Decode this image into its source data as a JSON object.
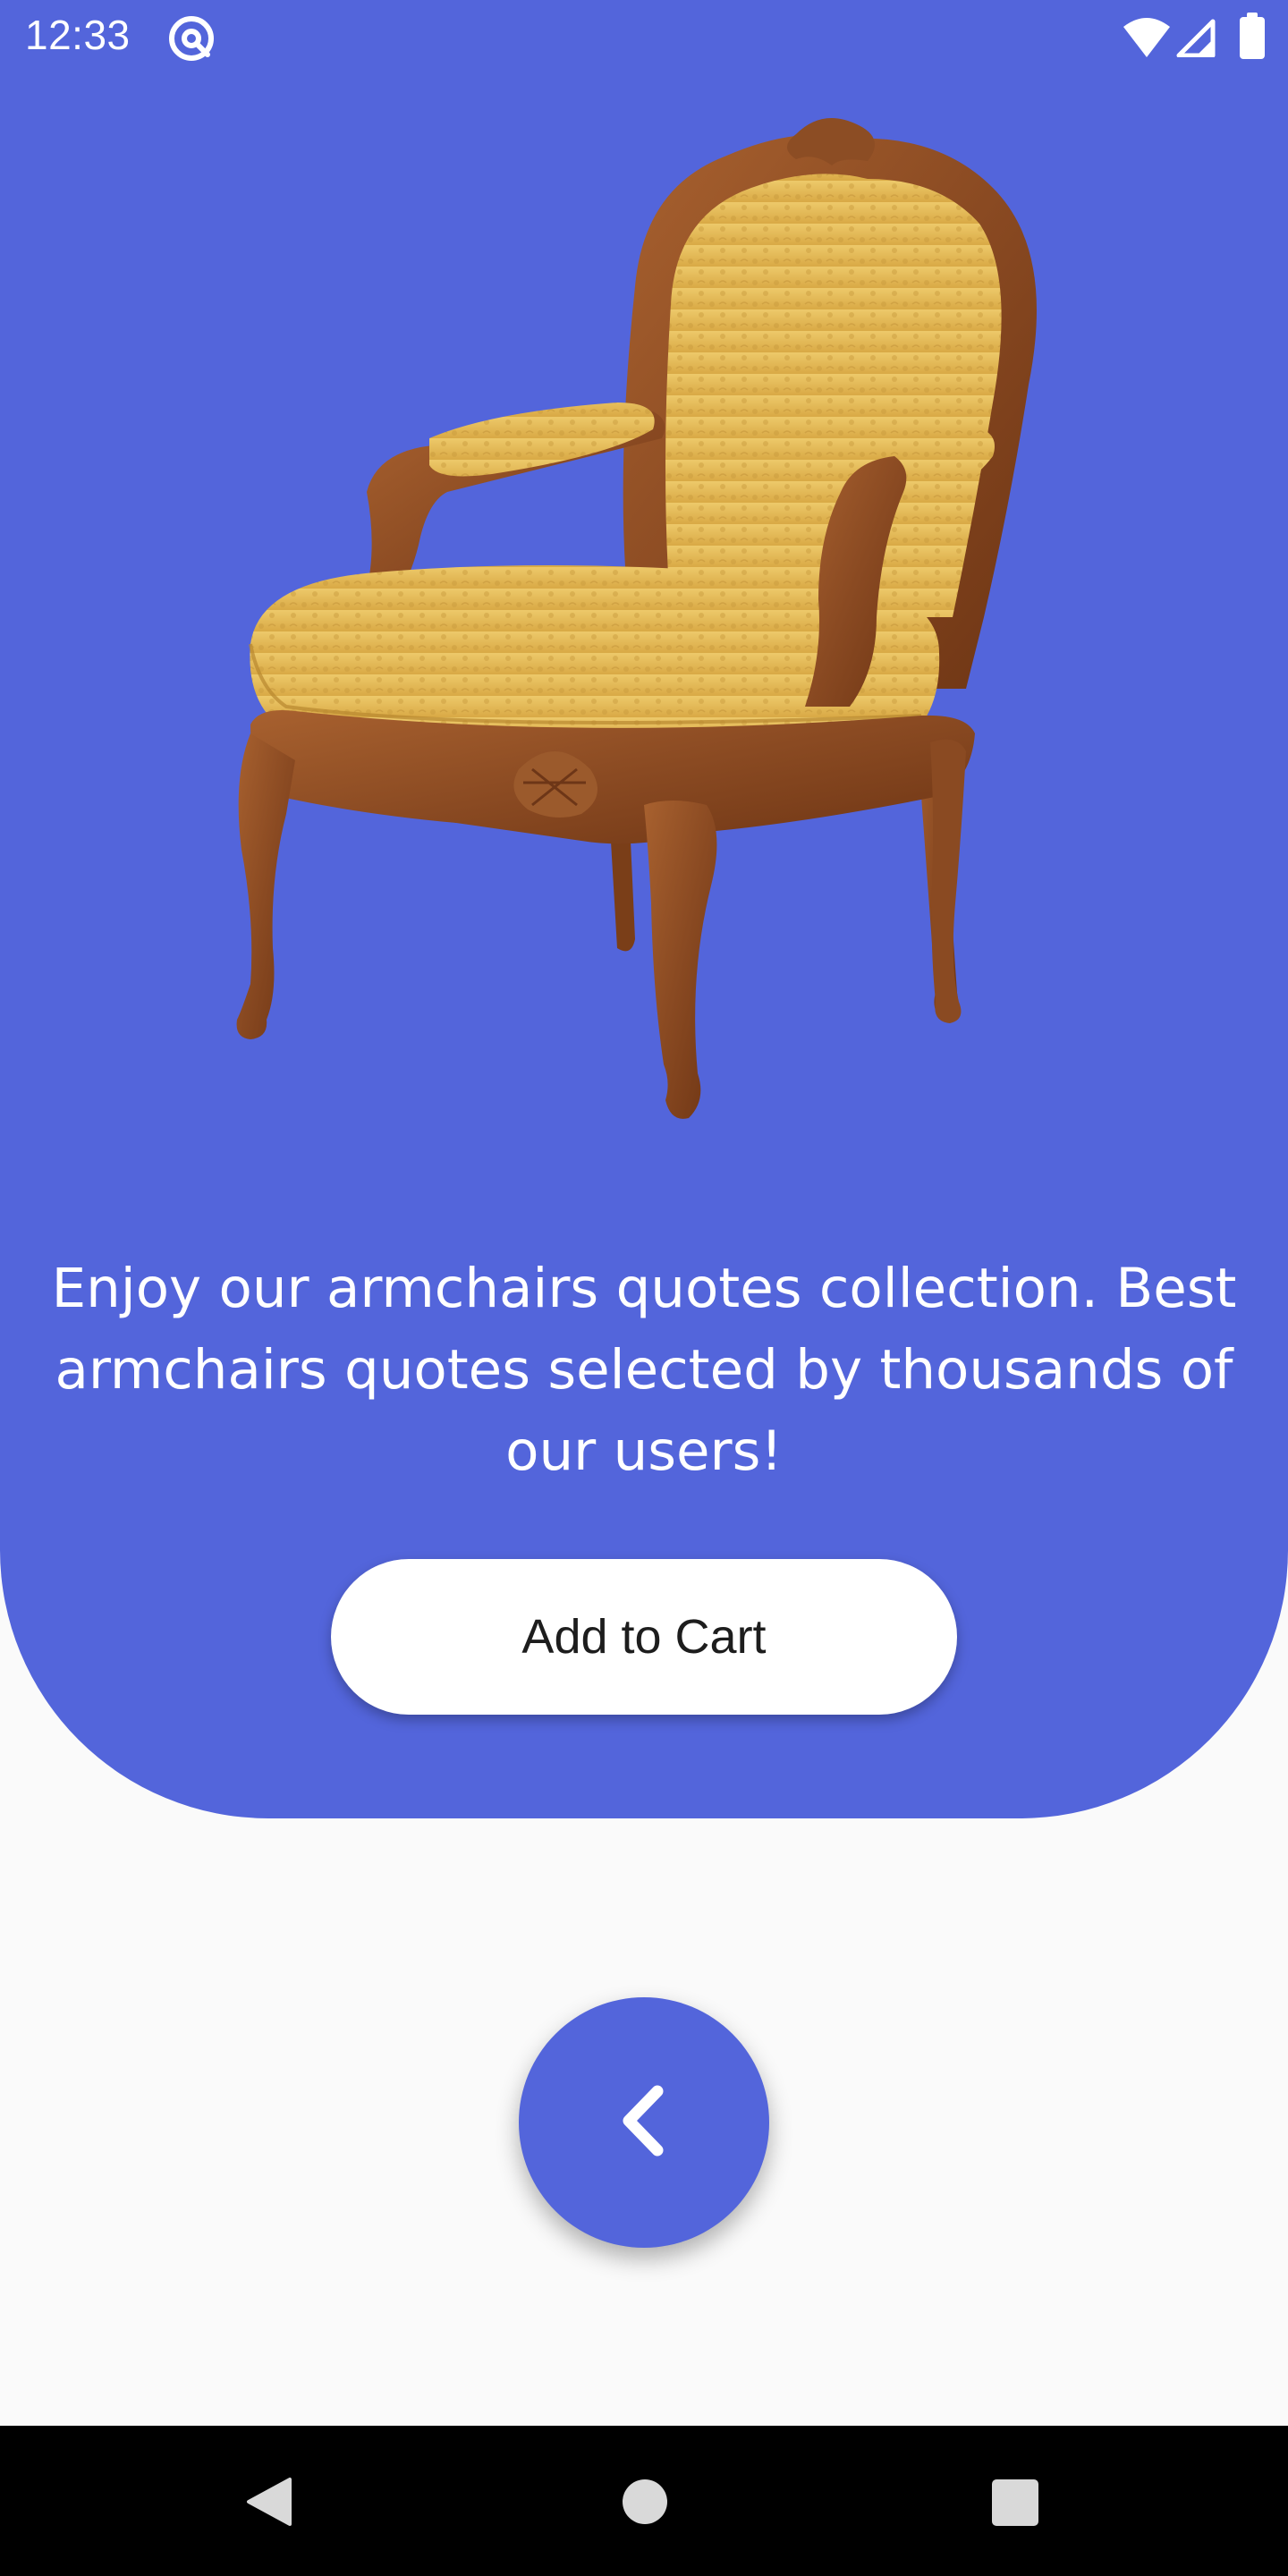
{
  "status_bar": {
    "time": "12:33",
    "icons": [
      "at-sign-icon",
      "wifi-icon",
      "cell-signal-icon",
      "battery-icon"
    ]
  },
  "product": {
    "image": "armchair-image",
    "description": "Enjoy our armchairs quotes collection. Best armchairs quotes selected by thousands of our users!",
    "cart_button_label": "Add to Cart"
  },
  "back_fab": {
    "icon": "chevron-left-icon"
  },
  "nav_bar": {
    "buttons": [
      "back-triangle-icon",
      "home-circle-icon",
      "recents-square-icon"
    ]
  },
  "colors": {
    "accent": "#5365db",
    "background": "#fafafa",
    "button_bg": "#ffffff",
    "button_text": "#1d1d1d",
    "nav_bar": "#000000"
  }
}
